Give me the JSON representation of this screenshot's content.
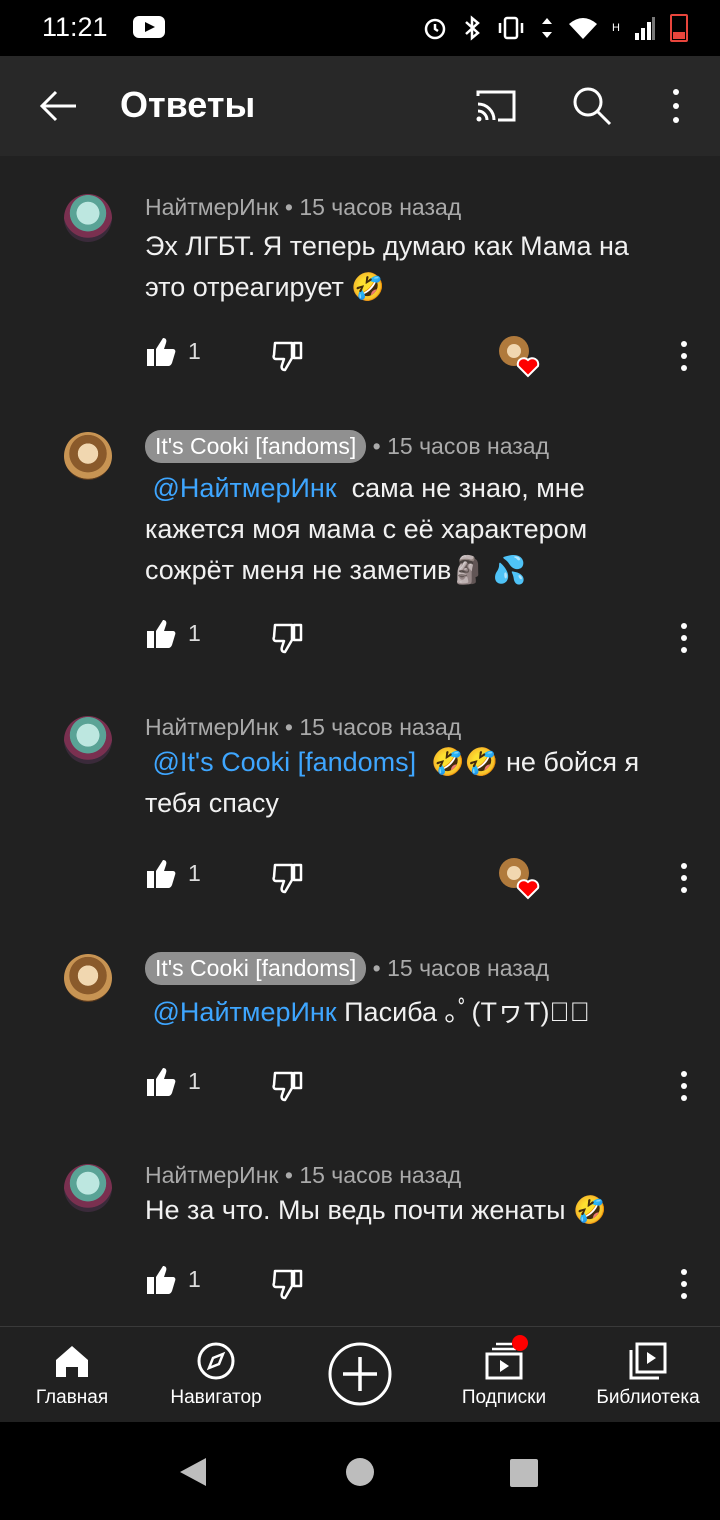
{
  "status_bar": {
    "time": "11:21",
    "signal_label": "H"
  },
  "header": {
    "title": "Ответы"
  },
  "comments": [
    {
      "author": "НайтмерИнк",
      "time": "15 часов назад",
      "text_lines": [
        "Эх ЛГБТ. Я теперь думаю как Мама на",
        "это отреагирует 🤣"
      ],
      "likes": "1"
    },
    {
      "author": "It's Cooki [fandoms]",
      "time": "15 часов назад",
      "mention": "@НайтмерИнк",
      "text_lines": [
        "сама не знаю, мне",
        "кажется моя мама с её характером",
        "сожрёт меня не заметив🗿 💦"
      ],
      "likes": "1"
    },
    {
      "author": "НайтмерИнк",
      "time": "15 часов назад",
      "mention": "@It's Cooki [fandoms]",
      "text_lines": [
        "🤣🤣 не бойся я",
        "тебя спасу"
      ],
      "likes": "1"
    },
    {
      "author": "It's Cooki [fandoms]",
      "time": "15 часов назад",
      "mention": "@НайтмерИнк",
      "text_lines": [
        "Пасиба ｡ﾟ(TヮT)ﾟ｡"
      ],
      "likes": "1"
    },
    {
      "author": "НайтмерИнк",
      "time": "15 часов назад",
      "text_lines": [
        "Не за что. Мы ведь почти женаты 🤣"
      ],
      "likes": "1"
    }
  ],
  "bottom_nav": [
    {
      "label": "Главная",
      "icon": "home-icon"
    },
    {
      "label": "Навигатор",
      "icon": "compass-icon"
    },
    {
      "label": "",
      "icon": "create-plus-icon"
    },
    {
      "label": "Подписки",
      "icon": "subscriptions-icon"
    },
    {
      "label": "Библиотека",
      "icon": "library-icon"
    }
  ],
  "colors": {
    "background": "#212121",
    "appbar": "#282828",
    "mention": "#3ea6ff",
    "heart": "#ff0000"
  }
}
